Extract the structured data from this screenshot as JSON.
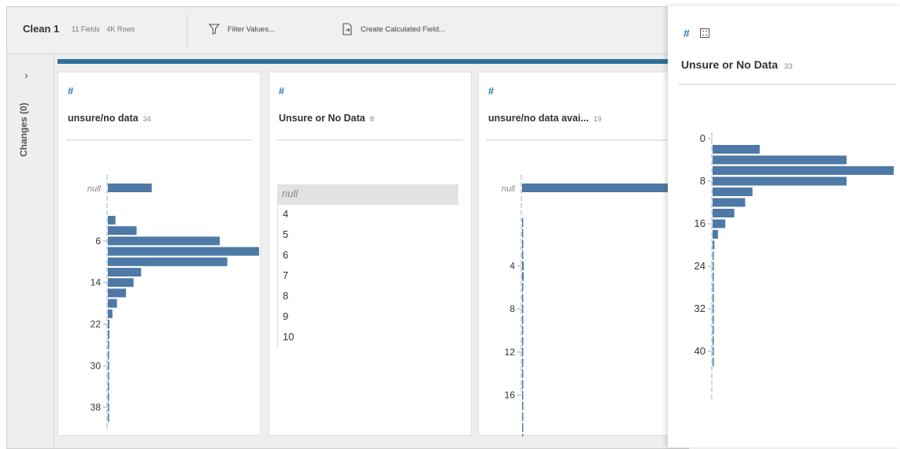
{
  "toolbar": {
    "title": "Clean 1",
    "fields": "11 Fields",
    "rows": "4K Rows",
    "filter_label": "Filter Values...",
    "calc_label": "Create Calculated Field..."
  },
  "sidebar": {
    "expand_glyph": "›",
    "changes_label": "Changes (0)"
  },
  "cards": [
    {
      "type_icon": "#",
      "title": "unsure/no data",
      "count": "34",
      "chart_data": {
        "type": "bar",
        "orientation": "horizontal",
        "null_value": 0.29,
        "bins_start": 2,
        "bin_width": 2,
        "values": [
          0.05,
          0.19,
          0.74,
          1.0,
          0.79,
          0.22,
          0.17,
          0.12,
          0.06,
          0.03,
          0.01,
          0.01,
          0.005,
          0.003,
          0.003,
          0.003,
          0.002,
          0.002,
          0.002,
          0.002
        ],
        "ticks": [
          "6",
          "14",
          "22",
          "30",
          "38"
        ],
        "tick_values": [
          6,
          14,
          22,
          30,
          38
        ],
        "null_label": "null",
        "xlabel": "",
        "ylabel": ""
      }
    },
    {
      "type_icon": "#",
      "title": "Unsure or No Data",
      "count": "8",
      "values": [
        "null",
        "4",
        "5",
        "6",
        "7",
        "8",
        "9",
        "10"
      ]
    },
    {
      "type_icon": "#",
      "title": "unsure/no data avai...",
      "count": "19",
      "chart_data": {
        "type": "bar",
        "orientation": "horizontal",
        "null_value": 1.0,
        "bins_start": 0,
        "bin_width": 1,
        "values": [
          0.002,
          0.002,
          0.002,
          0.002,
          0.01,
          0.01,
          0.002,
          0.002,
          0.002,
          0.002,
          0.002,
          0.002,
          0.002,
          0.002,
          0.002,
          0.002,
          0.002,
          0.002,
          0.002,
          0.002,
          0.002
        ],
        "ticks": [
          "4",
          "8",
          "12",
          "16"
        ],
        "tick_values": [
          4,
          8,
          12,
          16
        ],
        "null_label": "null",
        "xlabel": "",
        "ylabel": ""
      }
    }
  ],
  "panel": {
    "type_icon": "#",
    "title": "Unsure or No Data",
    "count": "33",
    "chart_data": {
      "type": "bar",
      "orientation": "horizontal",
      "bins_start": 2,
      "bin_width": 2,
      "values": [
        0.26,
        0.74,
        1.0,
        0.74,
        0.22,
        0.18,
        0.12,
        0.07,
        0.03,
        0.01,
        0.005,
        0.005,
        0.003,
        0.003,
        0.003,
        0.002,
        0.002,
        0.002,
        0.002,
        0.002,
        0.002
      ],
      "ticks": [
        "0",
        "8",
        "16",
        "24",
        "32",
        "40"
      ],
      "tick_values": [
        0,
        8,
        16,
        24,
        32,
        40
      ],
      "xlabel": "",
      "ylabel": ""
    }
  },
  "colors": {
    "bar": "#4e79a7",
    "accent": "#2f6f9c",
    "null_bg": "#e2e2e2"
  }
}
